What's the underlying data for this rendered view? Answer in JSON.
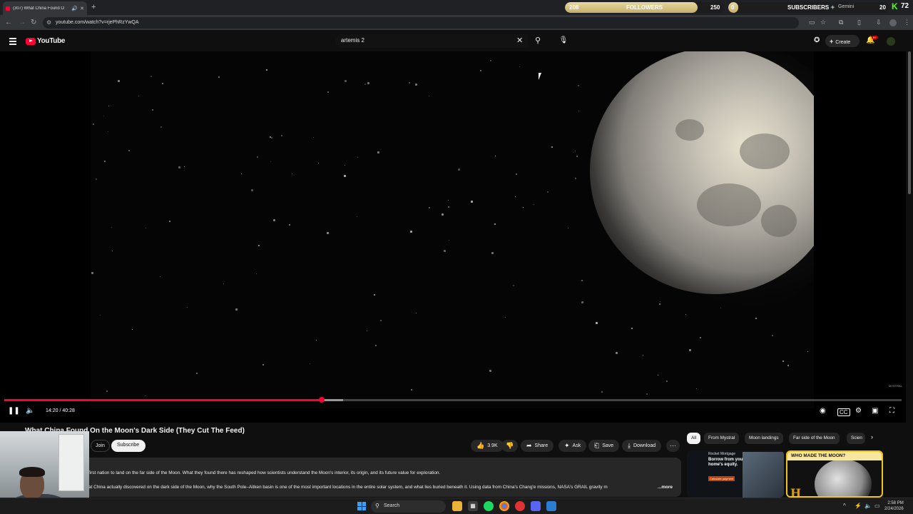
{
  "browser": {
    "tab_title": "(307) What China Found O",
    "url": "youtube.com/watch?v=rjePhRzYwQA"
  },
  "stream_overlay": {
    "followers_current": "208",
    "followers_label": "FOLLOWERS",
    "followers_goal": "250",
    "followers_fraction": 0.83,
    "subscribers_current": "0",
    "subscribers_label": "SUBSCRIBERS",
    "subscribers_source": "Gemini",
    "subscribers_goal": "20",
    "kick_count": "72"
  },
  "youtube": {
    "logo_text": "YouTube",
    "search_value": "artemis 2",
    "create_label": "Create",
    "notification_badge": "9+"
  },
  "player": {
    "time_current": "14:20",
    "time_total": "40:28",
    "timecode": "14:20 / 40:28",
    "progress_fraction": 0.354,
    "watermark": "MYSTRAL"
  },
  "video": {
    "title": "What China Found On the Moon's Dark Side (They Cut The Feed)",
    "join_label": "Join",
    "subscribe_label": "Subscribe",
    "likes": "3.9K",
    "share_label": "Share",
    "ask_label": "Ask",
    "save_label": "Save",
    "download_label": "Download",
    "description_line1": "first nation to land on the far side of the Moon. What they found there has reshaped how scientists understand the Moon's interior, its origin, and its future value for exploration.",
    "description_line2": "at China actually discovered on the dark side of the Moon, why the South Pole–Aitken basin is one of the most important locations in the entire solar system, and what lies buried beneath it. Using data from China's Chang'e missions, NASA's GRAIL gravity m",
    "more_label": "...more"
  },
  "related": {
    "chips": [
      "All",
      "From Mystral",
      "Moon landings",
      "Far side of the Moon",
      "Scien"
    ],
    "ad_brand": "Rocket Mortgage",
    "ad_headline": "Borrow from your home's equity.",
    "ad_cta": "Calculate payment",
    "moon_thumb_title": "WHO MADE THE MOON?",
    "moon_thumb_logo": "H"
  },
  "taskbar": {
    "search_label": "Search",
    "time": "2:58 PM",
    "date": "2/24/2026"
  },
  "colors": {
    "yt_red": "#ff0033",
    "accent_gold": "#e6d7a0",
    "kick_green": "#53fc18"
  }
}
